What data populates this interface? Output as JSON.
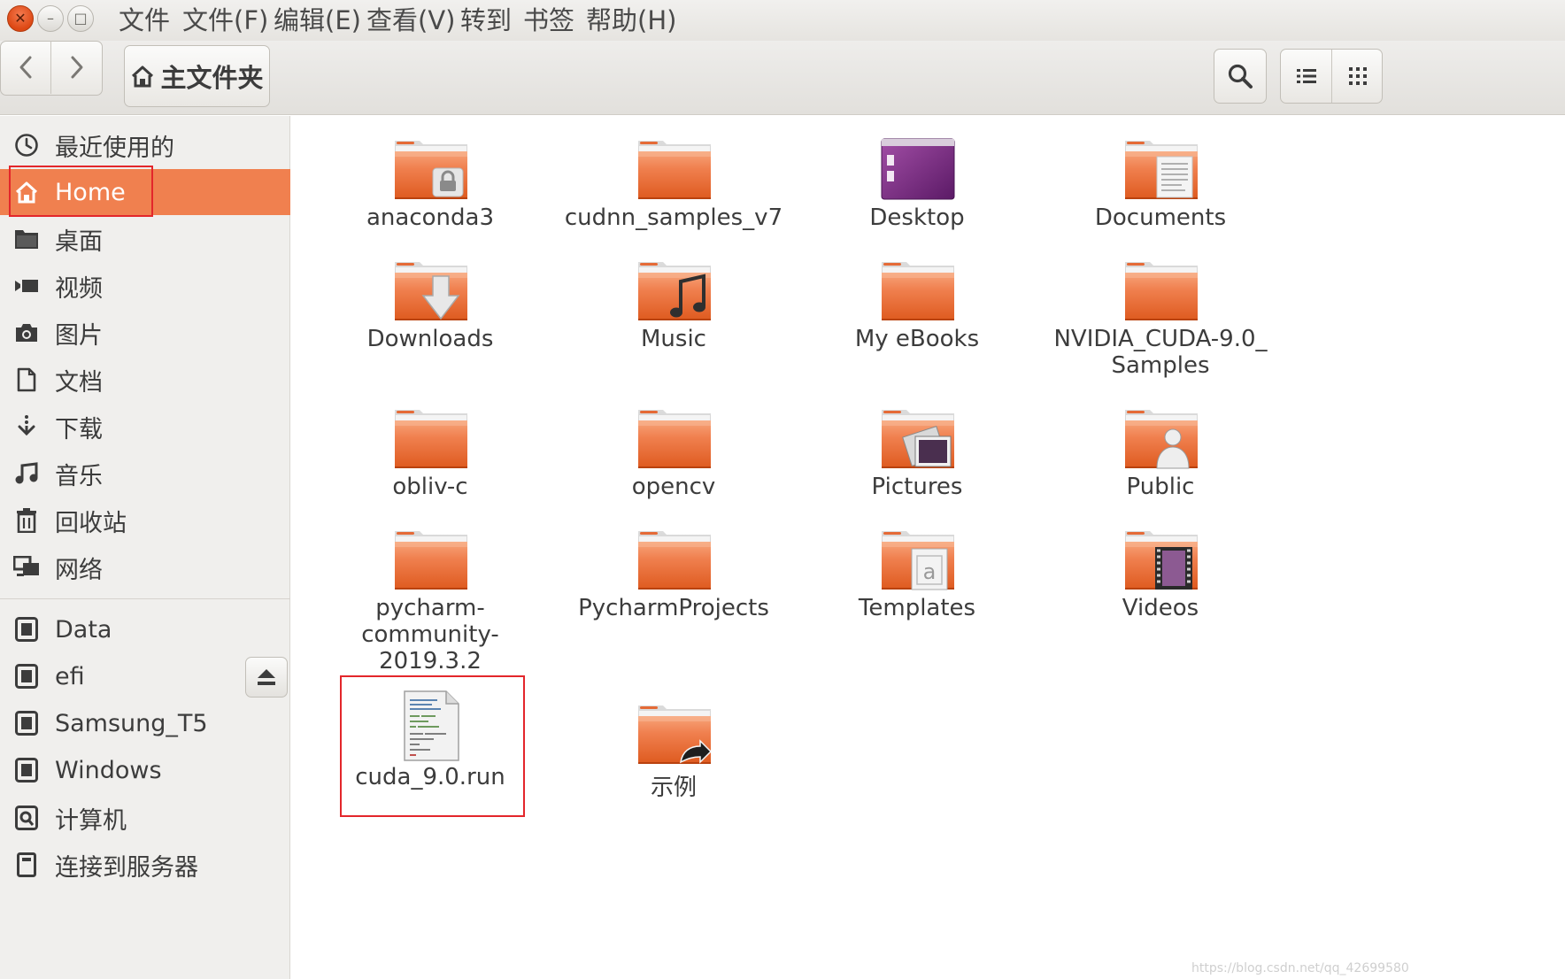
{
  "window": {
    "close_symbol": "✕",
    "minimize_symbol": "–",
    "maximize_symbol": "□"
  },
  "menu": [
    "文件",
    "文件(F)",
    "编辑(E)",
    "查看(V)",
    "转到",
    "书签",
    "帮助(H)"
  ],
  "toolbar": {
    "location_label": "主文件夹",
    "icons": {
      "back": "chevron-left-icon",
      "forward": "chevron-right-icon",
      "home": "home-icon",
      "search": "search-icon",
      "list_view": "list-view-icon",
      "grid_view": "grid-view-icon"
    }
  },
  "sidebar": {
    "places": [
      {
        "label": "最近使用的",
        "icon": "clock-icon"
      },
      {
        "label": "Home",
        "icon": "home-icon",
        "active": true
      },
      {
        "label": "桌面",
        "icon": "folder-icon"
      },
      {
        "label": "视频",
        "icon": "video-icon"
      },
      {
        "label": "图片",
        "icon": "camera-icon"
      },
      {
        "label": "文档",
        "icon": "document-icon"
      },
      {
        "label": "下载",
        "icon": "download-icon"
      },
      {
        "label": "音乐",
        "icon": "music-icon"
      },
      {
        "label": "回收站",
        "icon": "trash-icon"
      },
      {
        "label": "网络",
        "icon": "network-icon"
      }
    ],
    "devices": [
      {
        "label": "Data",
        "icon": "drive-icon"
      },
      {
        "label": "efi",
        "icon": "drive-icon",
        "ejectable": true
      },
      {
        "label": "Samsung_T5",
        "icon": "drive-icon"
      },
      {
        "label": "Windows",
        "icon": "drive-icon"
      },
      {
        "label": "计算机",
        "icon": "computer-icon"
      },
      {
        "label": "连接到服务器",
        "icon": "server-icon"
      }
    ],
    "eject_icon": "eject-icon"
  },
  "files": [
    {
      "name": "anaconda3",
      "icon": "folder-locked-icon"
    },
    {
      "name": "cudnn_samples_v7",
      "icon": "folder-icon"
    },
    {
      "name": "Desktop",
      "icon": "desktop-folder-icon"
    },
    {
      "name": "Documents",
      "icon": "folder-documents-icon"
    },
    {
      "name": "Downloads",
      "icon": "folder-download-icon"
    },
    {
      "name": "Music",
      "icon": "folder-music-icon"
    },
    {
      "name": "My eBooks",
      "icon": "folder-icon"
    },
    {
      "name": "NVIDIA_CUDA-9.0_\nSamples",
      "icon": "folder-icon"
    },
    {
      "name": "obliv-c",
      "icon": "folder-icon"
    },
    {
      "name": "opencv",
      "icon": "folder-icon"
    },
    {
      "name": "Pictures",
      "icon": "folder-pictures-icon"
    },
    {
      "name": "Public",
      "icon": "folder-public-icon"
    },
    {
      "name": "pycharm-\ncommunity-\n2019.3.2",
      "icon": "folder-icon"
    },
    {
      "name": "PycharmProjects",
      "icon": "folder-icon"
    },
    {
      "name": "Templates",
      "icon": "folder-templates-icon"
    },
    {
      "name": "Videos",
      "icon": "folder-videos-icon"
    },
    {
      "name": "cuda_9.0.run",
      "icon": "script-file-icon"
    },
    {
      "name": "示例",
      "icon": "folder-link-icon"
    }
  ],
  "watermark": "https://blog.csdn.net/qq_42699580",
  "colors": {
    "accent": "#f0804f",
    "folder": "#e95420",
    "highlight_box": "#e3262b"
  }
}
